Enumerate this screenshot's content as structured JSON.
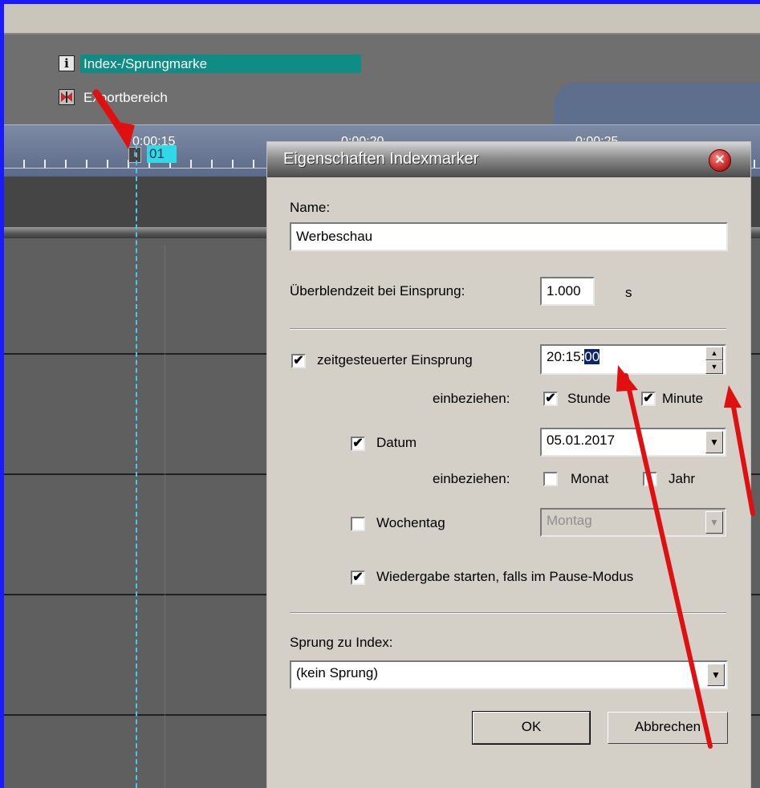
{
  "markers": {
    "index_label": "Index-/Sprungmarke",
    "export_label": "Exportbereich"
  },
  "ruler": {
    "times": [
      "0:00:15",
      "0:00:20",
      "0:00:25"
    ],
    "marker_badge": "i",
    "marker_name": "01"
  },
  "dialog": {
    "title": "Eigenschaften Indexmarker",
    "close_symbol": "✕",
    "name_label": "Name:",
    "name_value": "Werbeschau",
    "crossfade_label": "Überblendzeit bei Einsprung:",
    "crossfade_value": "1.000",
    "crossfade_unit": "s",
    "timed_label": "zeitgesteuerter Einsprung",
    "timed_checked": "✔",
    "time_prefix": "20:15:",
    "time_selected": "00",
    "include_label1": "einbeziehen:",
    "hour_label": "Stunde",
    "hour_checked": "✔",
    "minute_label": "Minute",
    "minute_checked": "✔",
    "date_label": "Datum",
    "date_checked": "✔",
    "date_value": "05.01.2017",
    "include_label2": "einbeziehen:",
    "month_label": "Monat",
    "year_label": "Jahr",
    "weekday_label": "Wochentag",
    "weekday_value": "Montag",
    "play_label": "Wiedergabe starten, falls im Pause-Modus",
    "play_checked": "✔",
    "jump_label": "Sprung zu Index:",
    "jump_value": "(kein Sprung)",
    "ok_label": "OK",
    "cancel_label": "Abbrechen"
  },
  "colors": {
    "frame": "#1a1aff",
    "marker_highlight": "#0f8c84",
    "annotation_arrow": "#e01010",
    "dialog_bg": "#d4d0c8"
  }
}
